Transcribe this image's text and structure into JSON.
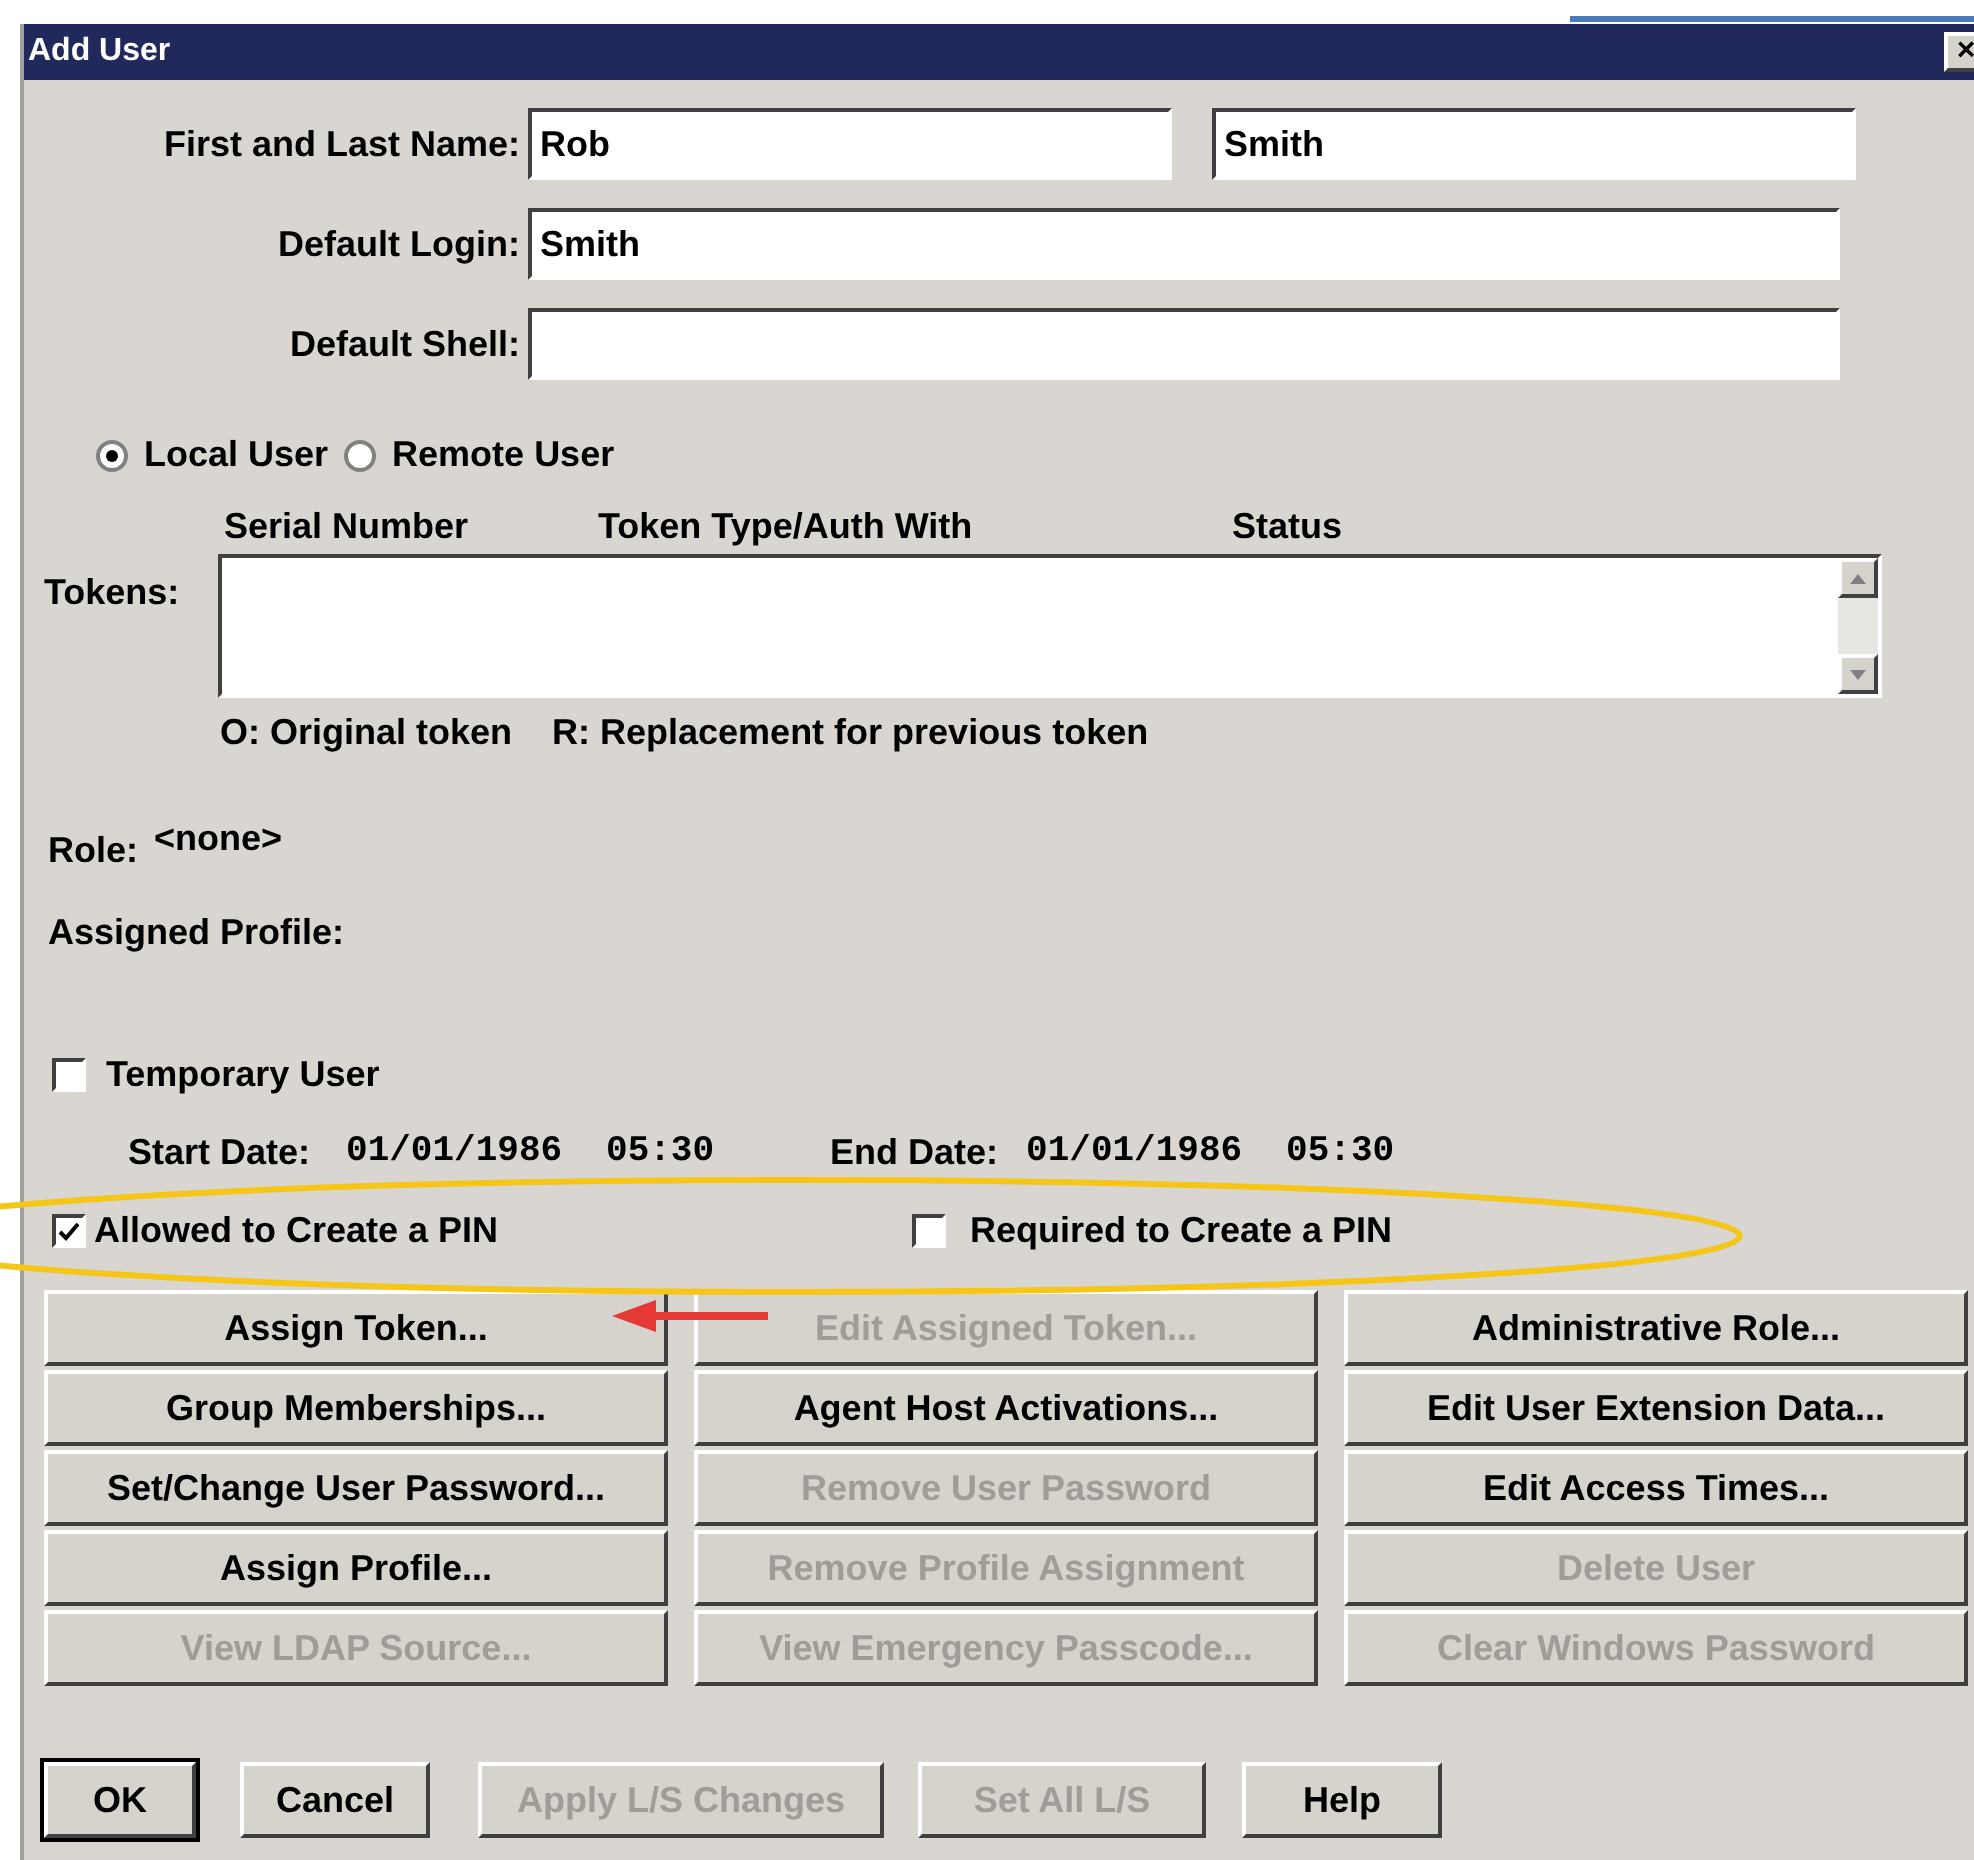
{
  "window": {
    "title": "Add User",
    "close": "×"
  },
  "name_row": {
    "label": "First and Last Name:",
    "first": "Rob",
    "last": "Smith"
  },
  "login": {
    "label": "Default Login:",
    "value": "Smith"
  },
  "shell": {
    "label": "Default Shell:"
  },
  "user_type": [
    {
      "label": "Local User",
      "selected": true
    },
    {
      "label": "Remote User",
      "selected": false
    }
  ],
  "tokens": {
    "label": "Tokens:",
    "columns": [
      "Serial Number",
      "Token Type/Auth With",
      "Status"
    ],
    "legend": [
      "O: Original token",
      "R: Replacement for previous token"
    ]
  },
  "role": {
    "label": "Role:",
    "value": "<none>"
  },
  "assigned_profile": {
    "label": "Assigned Profile:"
  },
  "temporary_user": {
    "label": "Temporary User",
    "checked": false
  },
  "dates": {
    "start_label": "Start Date:",
    "start_date": "01/01/1986",
    "start_time": "05:30",
    "end_label": "End Date:",
    "end_date": "01/01/1986",
    "end_time": "05:30"
  },
  "pin_options": [
    {
      "label": "Allowed to Create a PIN",
      "checked": true
    },
    {
      "label": "Required to Create a PIN",
      "checked": false
    }
  ],
  "action_buttons": [
    {
      "label": "Assign Token...",
      "disabled": false
    },
    {
      "label": "Edit Assigned Token...",
      "disabled": true
    },
    {
      "label": "Administrative Role...",
      "disabled": false
    },
    {
      "label": "Group Memberships...",
      "disabled": false
    },
    {
      "label": "Agent Host Activations...",
      "disabled": false
    },
    {
      "label": "Edit User Extension Data...",
      "disabled": false
    },
    {
      "label": "Set/Change User Password...",
      "disabled": false
    },
    {
      "label": "Remove User Password",
      "disabled": true
    },
    {
      "label": "Edit Access Times...",
      "disabled": false
    },
    {
      "label": "Assign Profile...",
      "disabled": false
    },
    {
      "label": "Remove Profile Assignment",
      "disabled": true
    },
    {
      "label": "Delete User",
      "disabled": true
    },
    {
      "label": "View LDAP Source...",
      "disabled": true
    },
    {
      "label": "View Emergency Passcode...",
      "disabled": true
    },
    {
      "label": "Clear Windows Password",
      "disabled": true
    }
  ],
  "footer_buttons": [
    {
      "label": "OK",
      "disabled": false,
      "default": true
    },
    {
      "label": "Cancel",
      "disabled": false,
      "default": false
    },
    {
      "label": "Apply L/S Changes",
      "disabled": true,
      "default": false
    },
    {
      "label": "Set All L/S",
      "disabled": true,
      "default": false
    },
    {
      "label": "Help",
      "disabled": false,
      "default": false
    }
  ]
}
